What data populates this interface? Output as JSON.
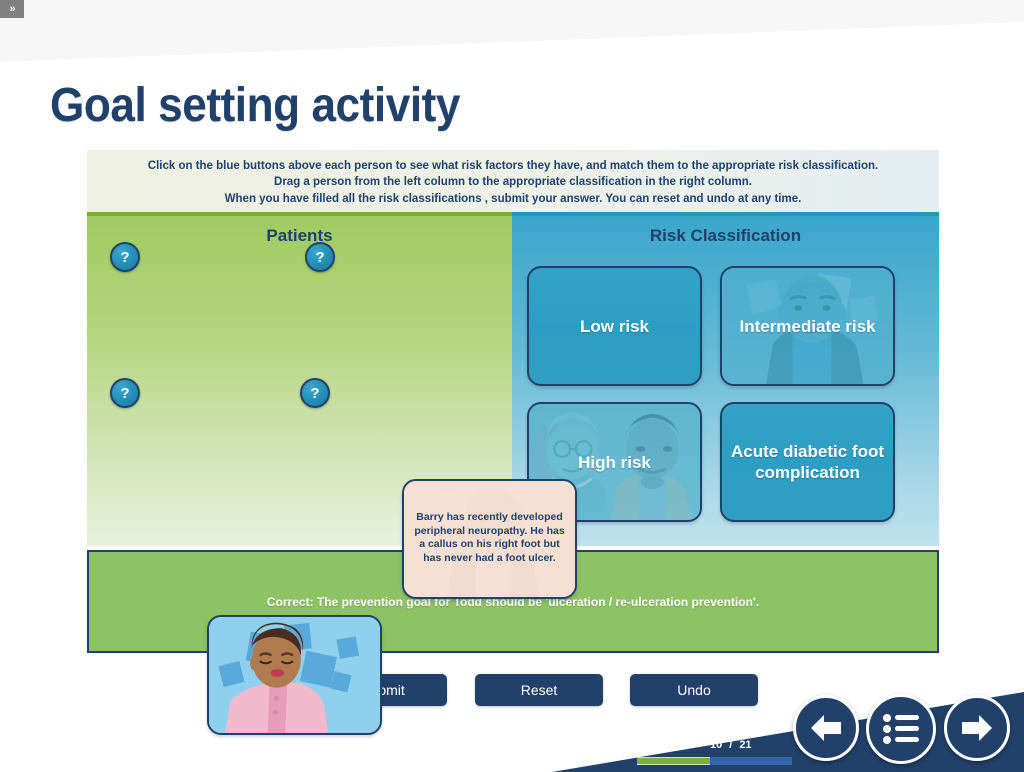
{
  "window": {
    "expand_label": "»"
  },
  "page_title": "Goal setting activity",
  "instructions": [
    "Click on the blue buttons above each person to see what risk factors they have, and match them to the appropriate  risk classification.",
    "Drag a person from the left column to the appropriate classification in the right column.",
    "When you have filled all the risk classifications , submit your answer. You can reset and undo at any time."
  ],
  "columns": {
    "patients_header": "Patients",
    "risk_header": "Risk Classification"
  },
  "help_buttons": [
    {
      "label": "?",
      "name": "help-button-1"
    },
    {
      "label": "?",
      "name": "help-button-2"
    },
    {
      "label": "?",
      "name": "help-button-3"
    },
    {
      "label": "?",
      "name": "help-button-4"
    }
  ],
  "patient_cards": [
    {
      "name": "patient-card-barry",
      "info_text": "Barry has recently developed peripheral neuropathy. He has a callus on his right foot but has never had a foot ulcer.",
      "state": "info-revealed"
    },
    {
      "name": "patient-card-woman",
      "info_text": "",
      "state": "image"
    }
  ],
  "risk_boxes": [
    {
      "label": "Low risk",
      "filled": false
    },
    {
      "label": "Intermediate risk",
      "filled": true
    },
    {
      "label": "High risk",
      "filled": true
    },
    {
      "label": "Acute diabetic foot complication",
      "filled": false
    }
  ],
  "feedback": {
    "text": "Correct: The prevention goal for Todd should be 'ulceration / re-ulceration prevention'."
  },
  "actions": {
    "submit": "Submit",
    "reset": "Reset",
    "undo": "Undo"
  },
  "nav": {
    "prev_icon": "arrow-left-icon",
    "menu_icon": "list-menu-icon",
    "next_icon": "arrow-right-icon",
    "current_page": "10",
    "separator": "/",
    "total_pages": "21",
    "progress_percent": 47
  },
  "colors": {
    "navy": "#21416b",
    "green": "#8dc265",
    "blue": "#2d9ec3",
    "peach": "#f6dfd1"
  }
}
